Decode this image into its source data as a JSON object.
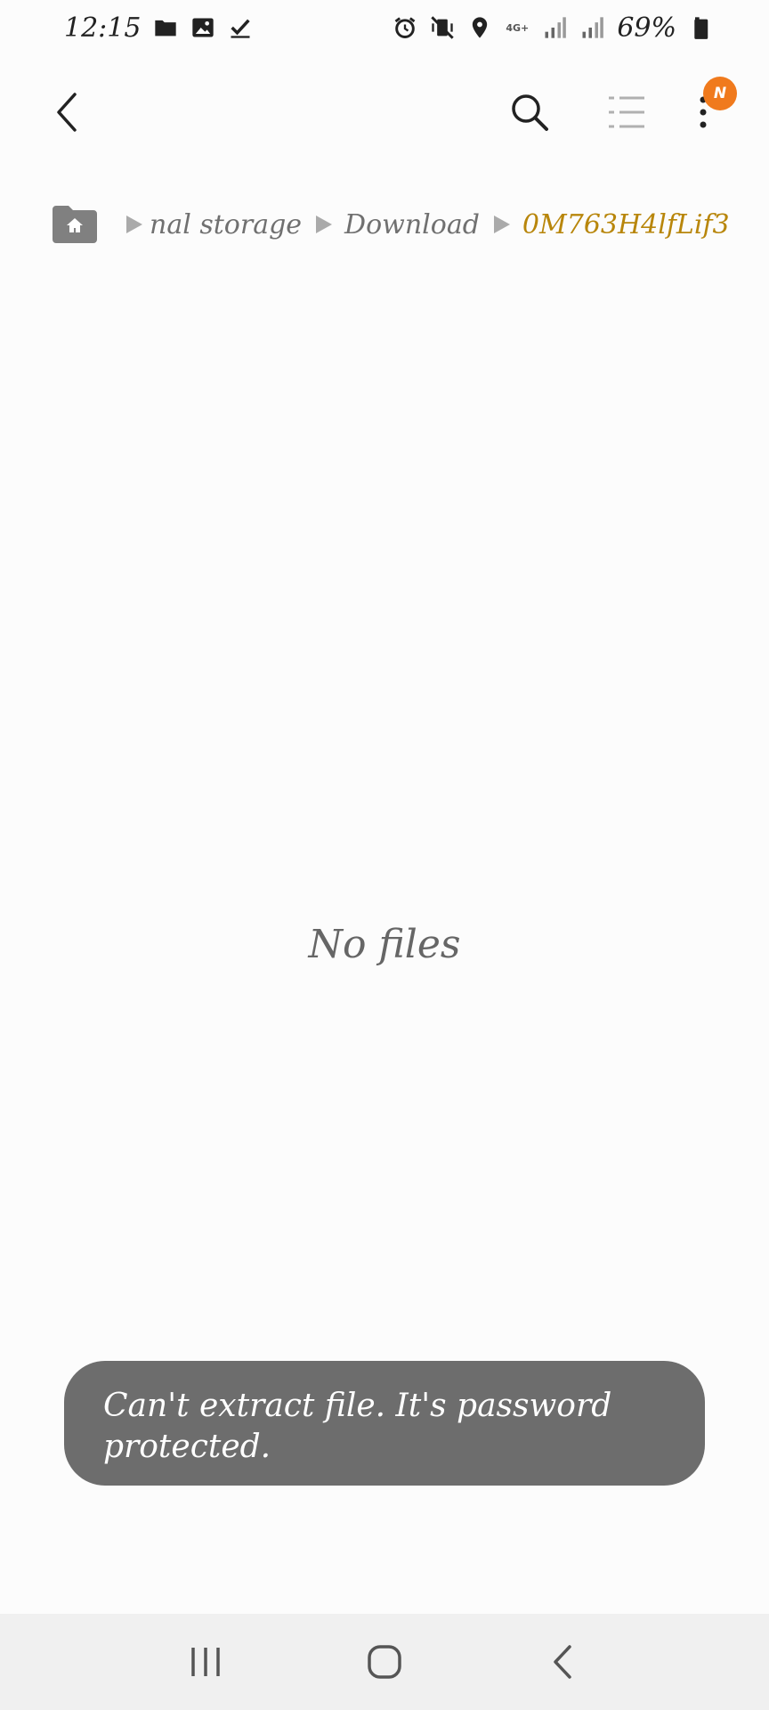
{
  "status_bar": {
    "time": "12:15",
    "network_label": "4G+",
    "battery_percent": "69%",
    "left_icons": [
      "folder-icon",
      "image-icon",
      "check-icon"
    ],
    "right_icons": [
      "alarm-icon",
      "vibrate-mute-icon",
      "location-icon",
      "network-4g-icon",
      "signal-icon",
      "signal-icon",
      "battery-icon"
    ]
  },
  "app_bar": {
    "icons": [
      "back-icon",
      "search-icon",
      "list-view-icon",
      "more-options-icon"
    ],
    "badge_text": "N",
    "badge_color": "#f07a1d"
  },
  "breadcrumb": {
    "home_icon": "home-folder-icon",
    "items": [
      {
        "label": "nal storage"
      },
      {
        "label": "Download"
      },
      {
        "label": "0M763H4lfLif3"
      }
    ],
    "current_color": "#b8860b"
  },
  "main": {
    "empty_message": "No files"
  },
  "toast": {
    "message": "Can't extract file. It's password protected."
  },
  "nav_bar": {
    "icons": [
      "recent-apps-icon",
      "home-icon",
      "back-icon"
    ]
  }
}
